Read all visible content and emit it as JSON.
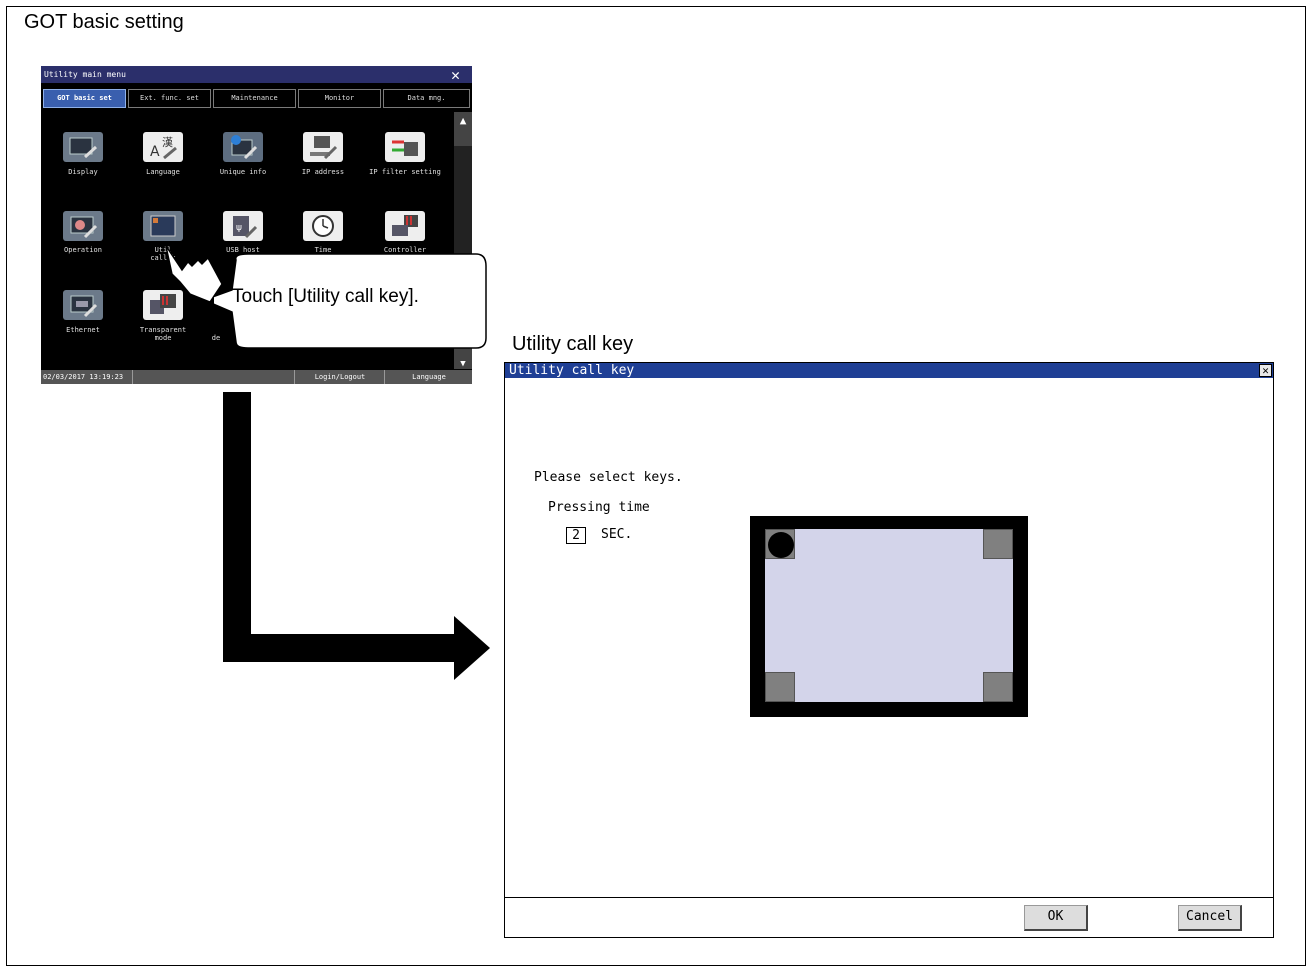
{
  "sections": {
    "left_title": "GOT basic setting",
    "right_title": "Utility call key"
  },
  "main_menu": {
    "title": "Utility main menu",
    "tabs": [
      {
        "label": "GOT basic set",
        "active": true
      },
      {
        "label": "Ext. func. set",
        "active": false
      },
      {
        "label": "Maintenance",
        "active": false
      },
      {
        "label": "Monitor",
        "active": false
      },
      {
        "label": "Data mng.",
        "active": false
      }
    ],
    "icons": [
      {
        "label": "Display",
        "icon": "display-wrench-icon"
      },
      {
        "label": "Language",
        "icon": "language-icon"
      },
      {
        "label": "Unique info",
        "icon": "unique-info-icon"
      },
      {
        "label": "IP address",
        "icon": "ip-address-icon"
      },
      {
        "label": "IP filter setting",
        "icon": "ip-filter-icon"
      },
      {
        "label": "Operation",
        "icon": "operation-icon"
      },
      {
        "label": "Util\ncall k",
        "icon": "utility-call-key-icon"
      },
      {
        "label": "USB host",
        "icon": "usb-host-icon"
      },
      {
        "label": "Time",
        "icon": "clock-icon"
      },
      {
        "label": "Controller",
        "icon": "controller-icon"
      },
      {
        "label": "Ethernet",
        "icon": "ethernet-icon"
      },
      {
        "label": "Transparent\nmode",
        "icon": "transparent-mode-icon"
      }
    ],
    "partial_label": "de",
    "status": {
      "datetime": "02/03/2017 13:19:23",
      "login_label": "Login/Logout",
      "language_label": "Language"
    }
  },
  "callout": {
    "text": "Touch [Utility call key]."
  },
  "dialog": {
    "title": "Utility call key",
    "prompt": "Please select keys.",
    "pressing_label": "Pressing time",
    "pressing_value": "2",
    "pressing_unit": "SEC.",
    "ok_label": "OK",
    "cancel_label": "Cancel",
    "selected_corner": "top-left"
  },
  "colors": {
    "menu_title_bar": "#2b2f6b",
    "active_tab": "#3a5fae",
    "dialog_title_bar": "#1f3f95",
    "screen_fill": "#d3d4ea"
  }
}
